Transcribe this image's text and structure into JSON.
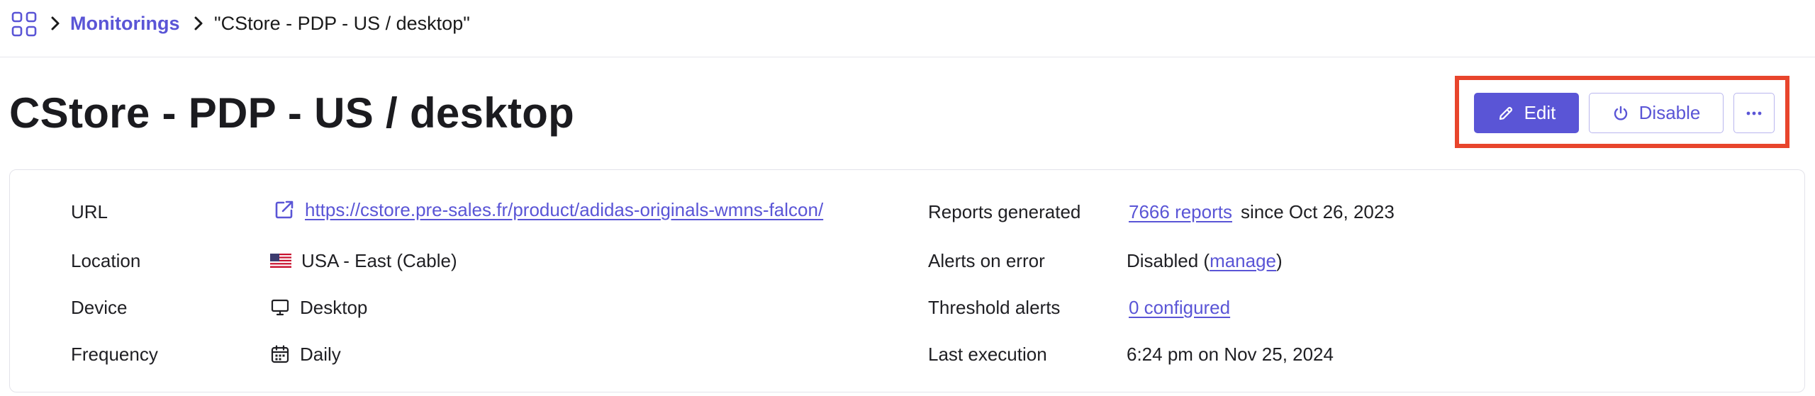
{
  "breadcrumb": {
    "apps_icon": "apps-grid-icon",
    "link_label": "Monitorings",
    "current": "\"CStore - PDP - US / desktop\""
  },
  "page": {
    "title": "CStore - PDP - US / desktop"
  },
  "actions": {
    "edit_label": "Edit",
    "disable_label": "Disable",
    "more_icon": "more-horizontal-icon",
    "highlight_color": "#e8452c",
    "accent_color": "#5a55d6"
  },
  "details": {
    "left": [
      {
        "label": "URL",
        "value": "https://cstore.pre-sales.fr/product/adidas-originals-wmns-falcon/",
        "icon": "external-link-icon"
      },
      {
        "label": "Location",
        "value": "USA - East (Cable)",
        "icon": "us-flag-icon"
      },
      {
        "label": "Device",
        "value": "Desktop",
        "icon": "monitor-icon"
      },
      {
        "label": "Frequency",
        "value": "Daily",
        "icon": "calendar-icon"
      }
    ],
    "right": {
      "reports_label": "Reports generated",
      "reports_link": "7666 reports",
      "reports_since": "since Oct 26, 2023",
      "alerts_label": "Alerts on error",
      "alerts_prefix": "Disabled (",
      "alerts_link": "manage",
      "alerts_suffix": ")",
      "threshold_label": "Threshold alerts",
      "threshold_link": "0 configured",
      "last_label": "Last execution",
      "last_value": "6:24 pm on Nov 25, 2024"
    }
  }
}
